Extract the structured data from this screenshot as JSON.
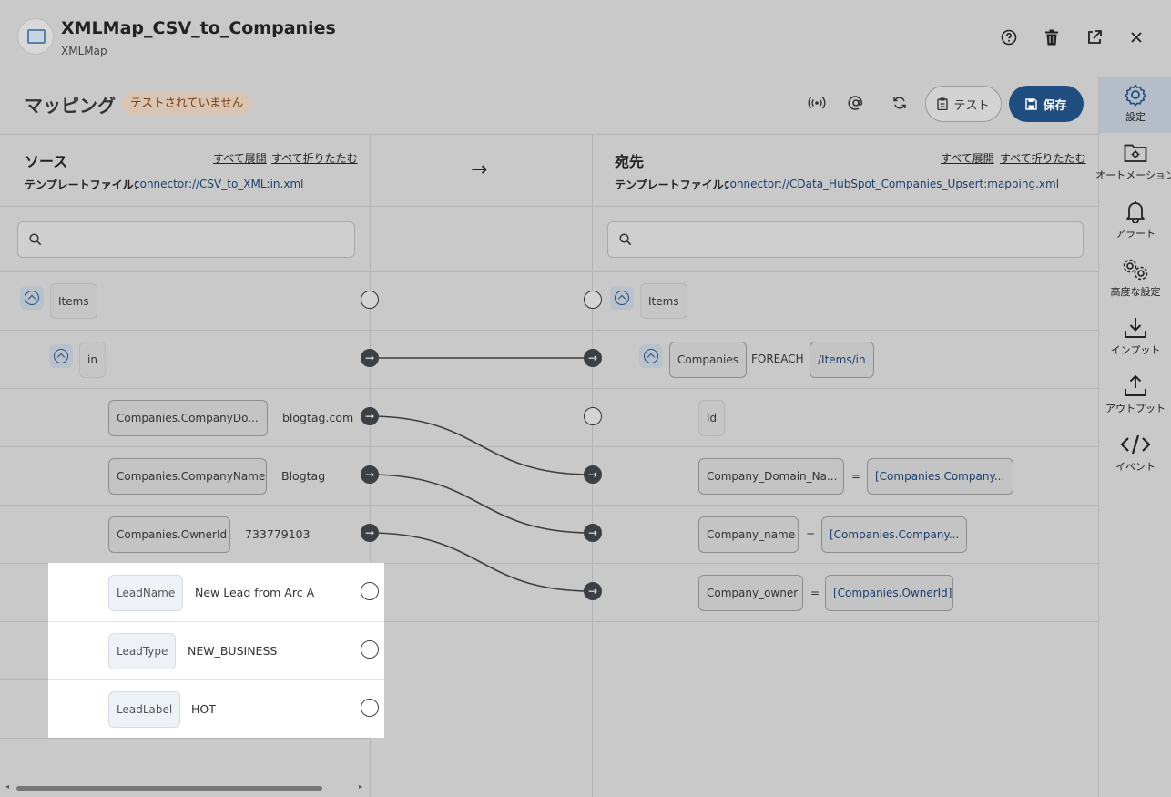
{
  "header": {
    "title": "XMLMap_CSV_to_Companies",
    "subtitle": "XMLMap",
    "icons": [
      "help-icon",
      "trash-icon",
      "open-external-icon",
      "close-icon"
    ]
  },
  "toolbar": {
    "section_title": "マッピング",
    "status_badge": "テストされていません",
    "icons": [
      "broadcast-icon",
      "at-icon",
      "refresh-icon"
    ],
    "test_label": "テスト",
    "save_label": "保存",
    "save_color": "#1f4d80",
    "badge_color": "#7a3d0c"
  },
  "sidebar": {
    "items": [
      {
        "label": "設定",
        "icon": "gear-icon",
        "active": true
      },
      {
        "label": "オートメーション",
        "icon": "folder-gear-icon"
      },
      {
        "label": "アラート",
        "icon": "bell-icon"
      },
      {
        "label": "高度な設定",
        "icon": "gears-icon"
      },
      {
        "label": "インプット",
        "icon": "download-icon"
      },
      {
        "label": "アウトプット",
        "icon": "upload-icon"
      },
      {
        "label": "イベント",
        "icon": "code-icon"
      }
    ]
  },
  "source": {
    "title": "ソース",
    "expand_all": "すべて展開",
    "collapse_all": "すべて折りたたむ",
    "template_label": "テンプレートファイル：",
    "template_link": "connector://CSV_to_XML:in.xml",
    "search_placeholder": "",
    "nodes": [
      {
        "label": "Items",
        "value": ""
      },
      {
        "label": "in",
        "value": ""
      },
      {
        "label": "Companies.CompanyDo...",
        "value": "blogtag.com"
      },
      {
        "label": "Companies.CompanyName",
        "value": "Blogtag"
      },
      {
        "label": "Companies.OwnerId",
        "value": "733779103"
      },
      {
        "label": "LeadName",
        "value": "New Lead from Arc A"
      },
      {
        "label": "LeadType",
        "value": "NEW_BUSINESS"
      },
      {
        "label": "LeadLabel",
        "value": "HOT"
      }
    ]
  },
  "middle": {
    "arrow": "→"
  },
  "destination": {
    "title": "宛先",
    "expand_all": "すべて展開",
    "collapse_all": "すべて折りたたむ",
    "template_label": "テンプレートファイル：",
    "template_link": "connector://CData_HubSpot_Companies_Upsert:mapping.xml",
    "search_placeholder": "",
    "nodes": [
      {
        "label": "Items"
      },
      {
        "label": "Companies",
        "keyword": "FOREACH",
        "expression": "/Items/in"
      },
      {
        "label": "Id"
      },
      {
        "label": "Company_Domain_Na...",
        "equals": "=",
        "expression": "[Companies.Company..."
      },
      {
        "label": "Company_name",
        "equals": "=",
        "expression": "[Companies.Company..."
      },
      {
        "label": "Company_owner",
        "equals": "=",
        "expression": "[Companies.OwnerId]"
      }
    ]
  },
  "mappings": [
    {
      "from": "in",
      "to": "Companies"
    },
    {
      "from": "Companies.CompanyDo...",
      "to": "Company_Domain_Na..."
    },
    {
      "from": "Companies.CompanyName",
      "to": "Company_name"
    },
    {
      "from": "Companies.OwnerId",
      "to": "Company_owner"
    }
  ]
}
